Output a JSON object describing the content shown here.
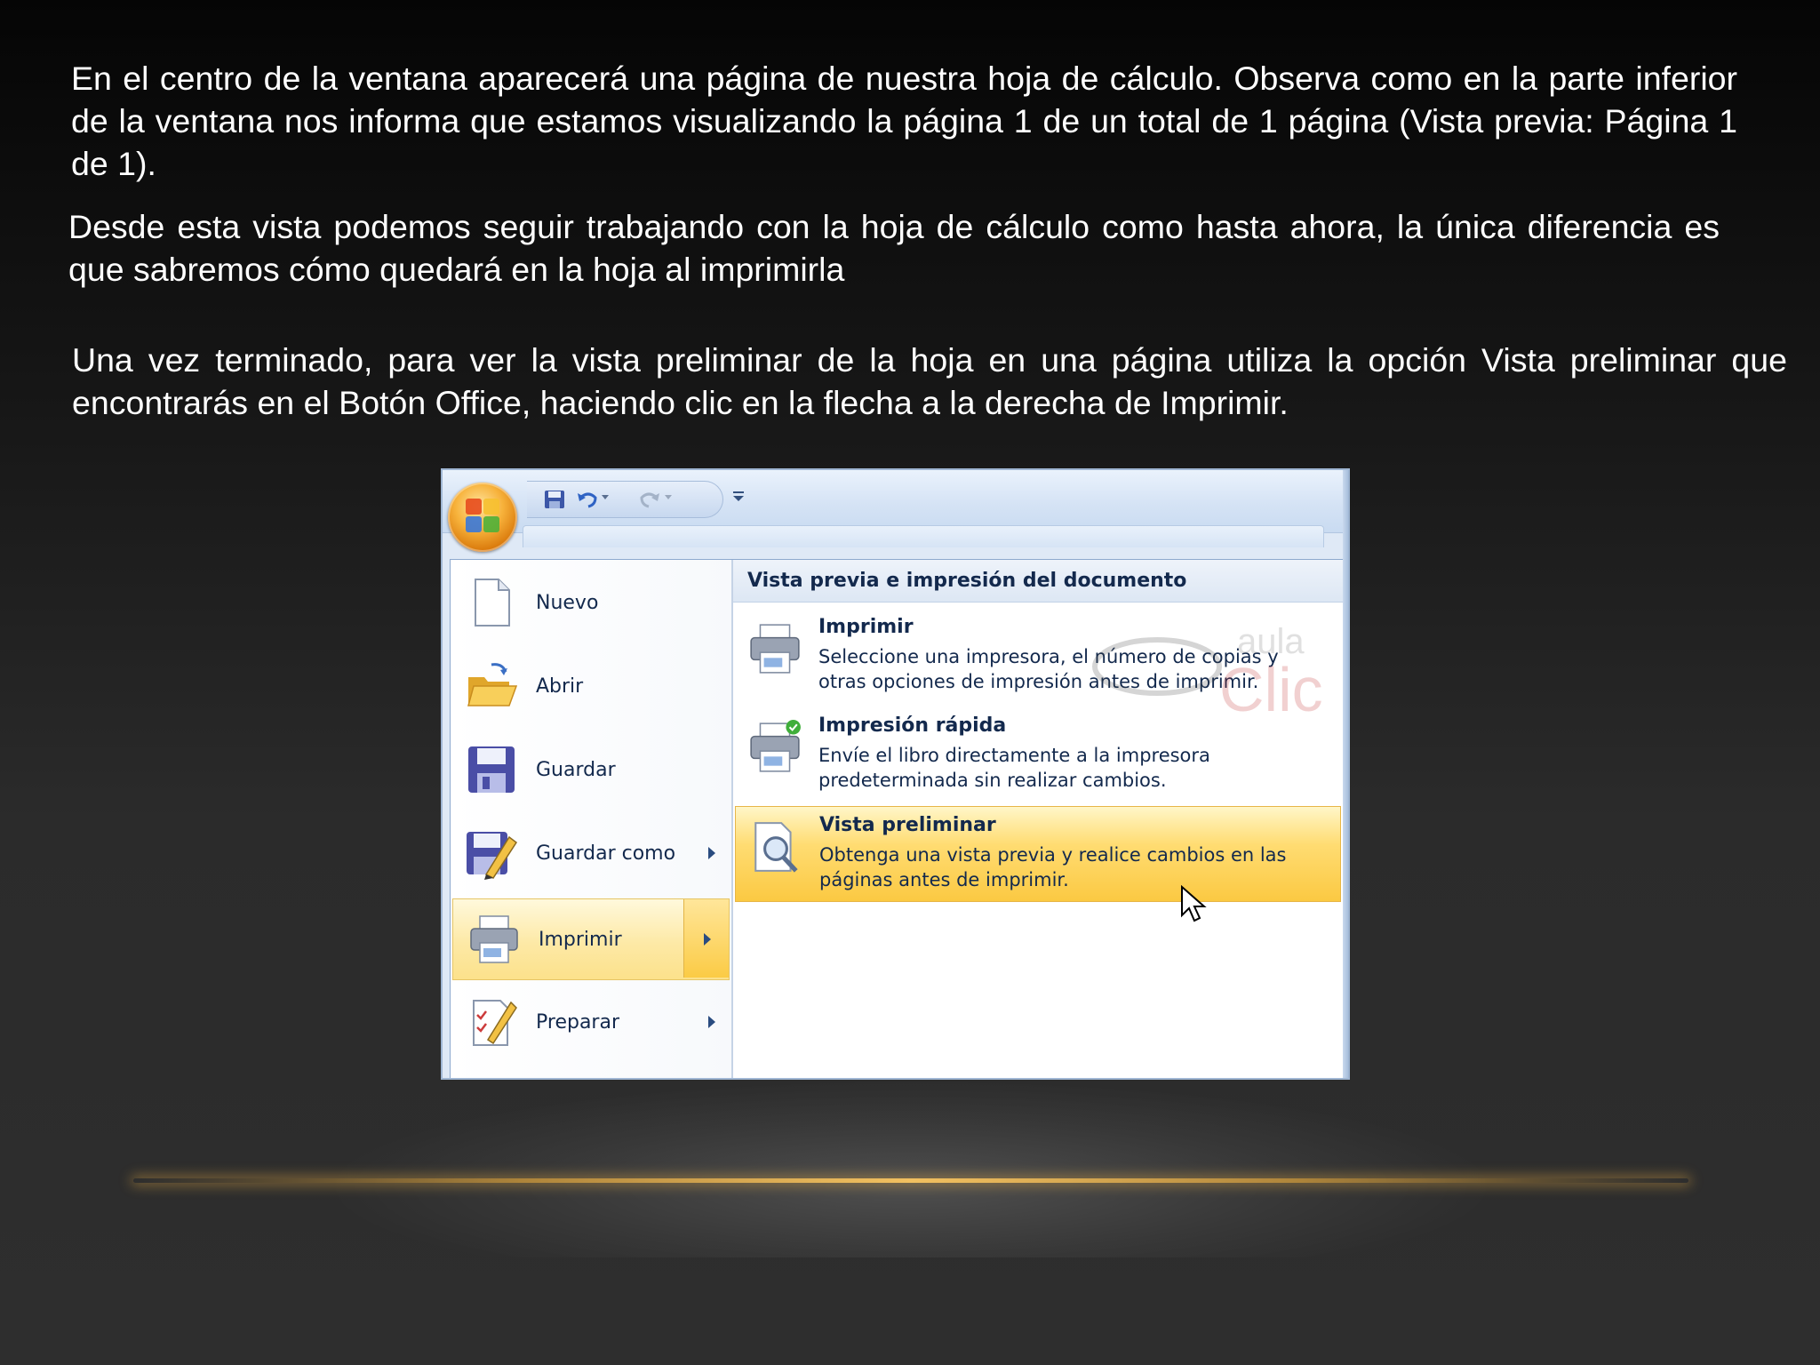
{
  "slide": {
    "paragraph_1": "En el centro de la ventana aparecerá una página de nuestra hoja de cálculo. Observa como en la parte inferior de la ventana nos informa que estamos visualizando la página 1 de un total de 1 página (Vista previa: Página 1 de 1).",
    "paragraph_2": "Desde esta vista podemos seguir trabajando con la hoja de cálculo como hasta ahora, la única diferencia es que sabremos cómo quedará en la hoja al imprimirla",
    "paragraph_3": "Una vez terminado, para ver la vista preliminar de la hoja en una página utiliza la opción Vista preliminar que encontrarás en el Botón Office, haciendo clic en la flecha a la derecha de Imprimir."
  },
  "screenshot": {
    "office_button_icon": "office-logo-icon",
    "quick_access": {
      "save_icon": "save-icon",
      "undo_icon": "undo-icon",
      "redo_icon": "redo-icon",
      "customize_icon": "customize-dropdown-icon"
    },
    "menu_items": [
      {
        "label": "Nuevo",
        "icon": "new-document-icon",
        "has_arrow": false
      },
      {
        "label": "Abrir",
        "icon": "open-folder-icon",
        "has_arrow": false
      },
      {
        "label": "Guardar",
        "icon": "save-disk-icon",
        "has_arrow": false
      },
      {
        "label": "Guardar como",
        "icon": "save-as-icon",
        "has_arrow": true
      },
      {
        "label": "Imprimir",
        "icon": "printer-icon",
        "has_arrow": true,
        "active": true
      },
      {
        "label": "Preparar",
        "icon": "prepare-icon",
        "has_arrow": true
      }
    ],
    "submenu": {
      "header": "Vista previa e impresión del documento",
      "items": [
        {
          "title": "Imprimir",
          "description": "Seleccione una impresora, el número de copias y otras opciones de impresión antes de imprimir.",
          "icon": "printer-icon"
        },
        {
          "title": "Impresión rápida",
          "description": "Envíe el libro directamente a la impresora predeterminada sin realizar cambios.",
          "icon": "quick-print-icon"
        },
        {
          "title": "Vista preliminar",
          "description": "Obtenga una vista previa y realice cambios en las páginas antes de imprimir.",
          "icon": "print-preview-icon",
          "active": true
        }
      ]
    },
    "watermark": {
      "line1": "aula",
      "line2": "Clic"
    }
  },
  "colors": {
    "slide_text": "#ffffff",
    "highlight": "#fbc942",
    "accent_line": "#f2c060"
  }
}
